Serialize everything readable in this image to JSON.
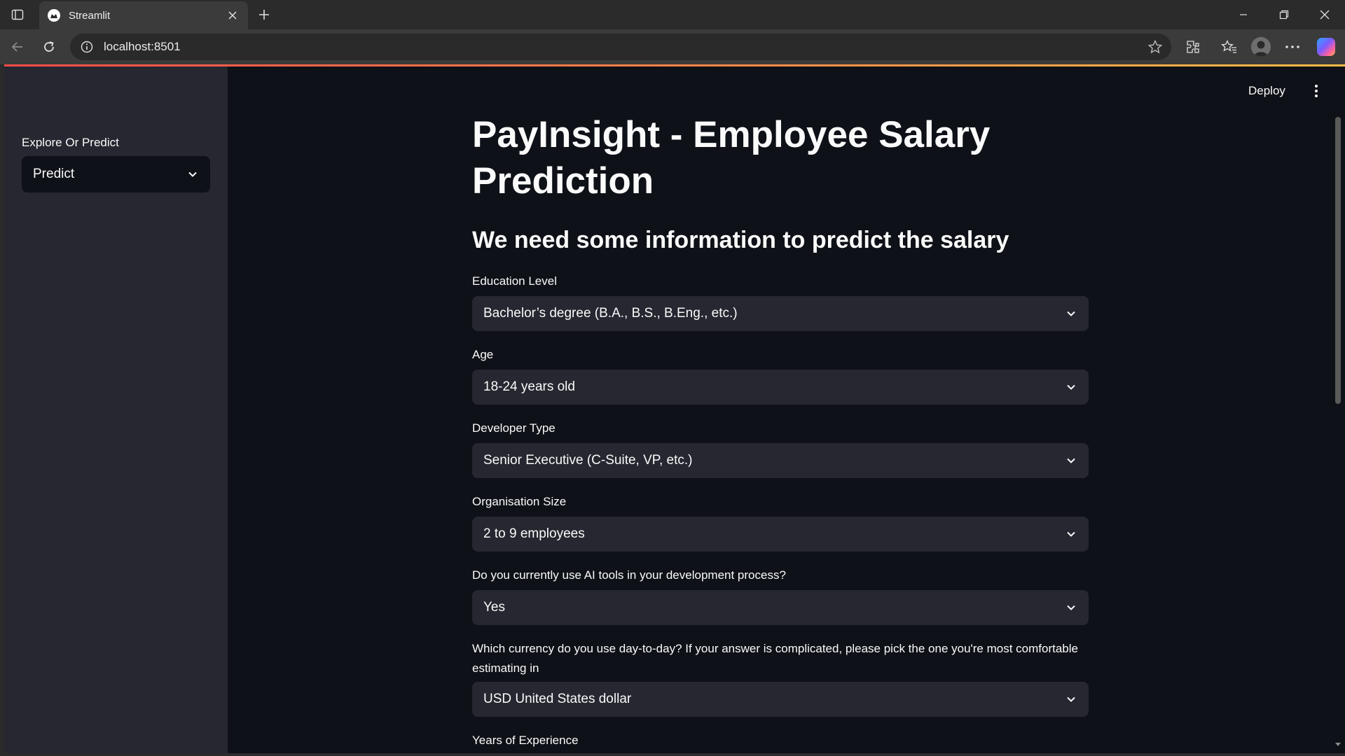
{
  "browser": {
    "tab_title": "Streamlit",
    "url": "localhost:8501"
  },
  "sidebar": {
    "label": "Explore Or Predict",
    "selected": "Predict"
  },
  "header": {
    "deploy_label": "Deploy"
  },
  "main": {
    "title": "PayInsight - Employee Salary Prediction",
    "subtitle": "We need some information to predict the salary",
    "fields": [
      {
        "label": "Education Level",
        "value": "Bachelor’s degree (B.A., B.S., B.Eng., etc.)"
      },
      {
        "label": "Age",
        "value": "18-24 years old"
      },
      {
        "label": "Developer Type",
        "value": "Senior Executive (C-Suite, VP, etc.)"
      },
      {
        "label": "Organisation Size",
        "value": "2 to 9 employees"
      },
      {
        "label": "Do you currently use AI tools in your development process?",
        "value": "Yes"
      },
      {
        "label": "Which currency do you use day-to-day? If your answer is complicated, please pick the one you're most comfortable estimating in",
        "value": "USD United States dollar"
      },
      {
        "label": "Years of Experience"
      }
    ]
  },
  "colors": {
    "app_bg": "#0e1117",
    "sidebar_bg": "#262730",
    "select_bg": "#262730",
    "text": "#fafafa",
    "accent_start": "#ff4b4b",
    "accent_end": "#ffbd45"
  },
  "icons": [
    "sidebar-toggle-icon",
    "streamlit-favicon",
    "close-icon",
    "plus-icon",
    "minimize-icon",
    "restore-icon",
    "back-icon",
    "reload-icon",
    "info-icon",
    "star-icon",
    "extensions-icon",
    "favorites-icon",
    "more-icon",
    "copilot-icon",
    "chevron-down-icon",
    "kebab-menu-icon"
  ]
}
